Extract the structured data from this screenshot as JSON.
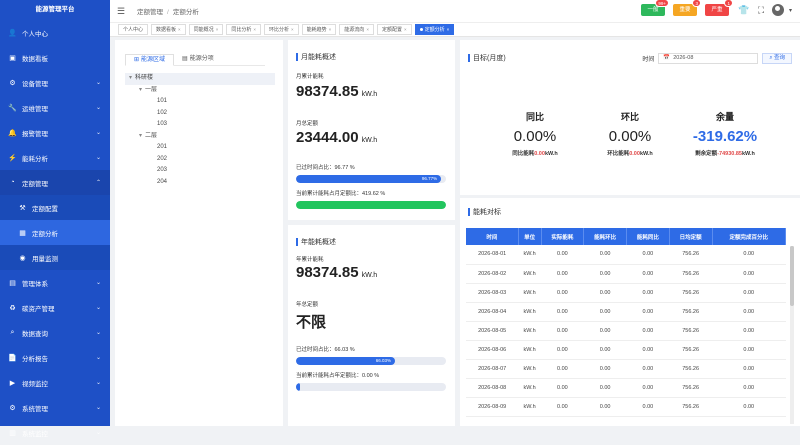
{
  "app": {
    "title": "能源管理平台"
  },
  "sidebar": {
    "items": [
      {
        "label": "个人中心",
        "icon": "person-icon",
        "expand": false
      },
      {
        "label": "数据看板",
        "icon": "dashboard-icon",
        "expand": false
      },
      {
        "label": "设备管理",
        "icon": "device-icon",
        "expand": true
      },
      {
        "label": "运维管理",
        "icon": "maintenance-icon",
        "expand": true
      },
      {
        "label": "报警管理",
        "icon": "alarm-icon",
        "expand": true
      },
      {
        "label": "能耗分析",
        "icon": "energy-icon",
        "expand": true
      },
      {
        "label": "定额管理",
        "icon": "quota-icon",
        "expand": true,
        "open": true
      }
    ],
    "sub_items": [
      {
        "label": "定额配置",
        "icon": "config-icon"
      },
      {
        "label": "定额分析",
        "icon": "analysis-icon",
        "active": true
      },
      {
        "label": "用量监测",
        "icon": "monitor-icon"
      }
    ],
    "items2": [
      {
        "label": "管理体系",
        "icon": "system-icon"
      },
      {
        "label": "碳资产管理",
        "icon": "carbon-icon"
      },
      {
        "label": "数据查询",
        "icon": "query-icon"
      },
      {
        "label": "分析报告",
        "icon": "report-icon"
      },
      {
        "label": "视频监控",
        "icon": "video-icon"
      },
      {
        "label": "系统管理",
        "icon": "settings-icon"
      },
      {
        "label": "系统监控",
        "icon": "sysmonitor-icon"
      }
    ]
  },
  "header": {
    "breadcrumb": [
      "定额管理",
      "定额分析"
    ],
    "buttons": [
      {
        "label": "一般",
        "badge": "99+",
        "color": "#2eb85c"
      },
      {
        "label": "重要",
        "badge": "3",
        "color": "#f5a623"
      },
      {
        "label": "严重",
        "badge": "1",
        "color": "#f04545"
      }
    ]
  },
  "tabs": [
    {
      "label": "个人中心",
      "closable": false
    },
    {
      "label": "数据看板",
      "closable": true
    },
    {
      "label": "同能概况",
      "closable": true
    },
    {
      "label": "同比分析",
      "closable": true
    },
    {
      "label": "环比分析",
      "closable": true
    },
    {
      "label": "能耗趋势",
      "closable": true
    },
    {
      "label": "能源流向",
      "closable": true
    },
    {
      "label": "定额配置",
      "closable": true
    },
    {
      "label": "定额分析",
      "closable": true,
      "active": true
    }
  ],
  "tree_panel": {
    "tabs": [
      "能源区域",
      "能源分项"
    ],
    "nodes": [
      {
        "label": "科研楼",
        "level": 0,
        "toggle": "▾"
      },
      {
        "label": "一层",
        "level": 1,
        "toggle": "▾"
      },
      {
        "label": "101",
        "level": 2
      },
      {
        "label": "102",
        "level": 2
      },
      {
        "label": "103",
        "level": 2
      },
      {
        "label": "二层",
        "level": 1,
        "toggle": "▾"
      },
      {
        "label": "201",
        "level": 2
      },
      {
        "label": "202",
        "level": 2
      },
      {
        "label": "203",
        "level": 2
      },
      {
        "label": "204",
        "level": 2
      }
    ]
  },
  "month": {
    "title": "月能耗概述",
    "cumulative_label": "月累计能耗",
    "cumulative_value": "98374.85",
    "unit": "kW.h",
    "quota_label": "月总定额",
    "quota_value": "23444.00",
    "time_ratio_label": "已过时间占比：96.77 %",
    "time_ratio": 0.9677,
    "time_ratio_text": "96.77%",
    "usage_ratio_label": "当前累计能耗占月定额比：419.62 %",
    "usage_ratio": 1.0,
    "usage_color": "#22c55e"
  },
  "year": {
    "title": "年能耗概述",
    "cumulative_label": "年累计能耗",
    "cumulative_value": "98374.85",
    "unit": "kW.h",
    "quota_label": "年总定额",
    "quota_value": "不限",
    "time_ratio_label": "已过时间占比：66.03 %",
    "time_ratio": 0.6603,
    "time_ratio_text": "66.03%",
    "usage_ratio_label": "当前累计能耗占年定额比：0.00 %",
    "usage_ratio": 0
  },
  "target": {
    "title": "目标(月度)",
    "time_label": "时间",
    "date": "2026-08",
    "query_label": "查询",
    "stats": [
      {
        "label": "同比",
        "value": "0.00%",
        "sub_label": "同比能耗",
        "sub_value": "0.00",
        "sub_unit": "kW.h"
      },
      {
        "label": "环比",
        "value": "0.00%",
        "sub_label": "环比能耗",
        "sub_value": "0.00",
        "sub_unit": "kW.h"
      },
      {
        "label": "余量",
        "value": "-319.62%",
        "sub_label": "剩余定额",
        "sub_value": "-74930.85",
        "sub_unit": "kW.h",
        "value_color": "#2e6be6"
      }
    ]
  },
  "compare": {
    "title": "能耗对标",
    "columns": [
      "时间",
      "单位",
      "实际能耗",
      "能耗环比",
      "能耗同比",
      "日均定额",
      "定额完成百分比"
    ],
    "rows": [
      [
        "2026-08-01",
        "kW.h",
        "0.00",
        "0.00",
        "0.00",
        "756.26",
        "0.00"
      ],
      [
        "2026-08-02",
        "kW.h",
        "0.00",
        "0.00",
        "0.00",
        "756.26",
        "0.00"
      ],
      [
        "2026-08-03",
        "kW.h",
        "0.00",
        "0.00",
        "0.00",
        "756.26",
        "0.00"
      ],
      [
        "2026-08-04",
        "kW.h",
        "0.00",
        "0.00",
        "0.00",
        "756.26",
        "0.00"
      ],
      [
        "2026-08-05",
        "kW.h",
        "0.00",
        "0.00",
        "0.00",
        "756.26",
        "0.00"
      ],
      [
        "2026-08-06",
        "kW.h",
        "0.00",
        "0.00",
        "0.00",
        "756.26",
        "0.00"
      ],
      [
        "2026-08-07",
        "kW.h",
        "0.00",
        "0.00",
        "0.00",
        "756.26",
        "0.00"
      ],
      [
        "2026-08-08",
        "kW.h",
        "0.00",
        "0.00",
        "0.00",
        "756.26",
        "0.00"
      ],
      [
        "2026-08-09",
        "kW.h",
        "0.00",
        "0.00",
        "0.00",
        "756.26",
        "0.00"
      ]
    ]
  }
}
